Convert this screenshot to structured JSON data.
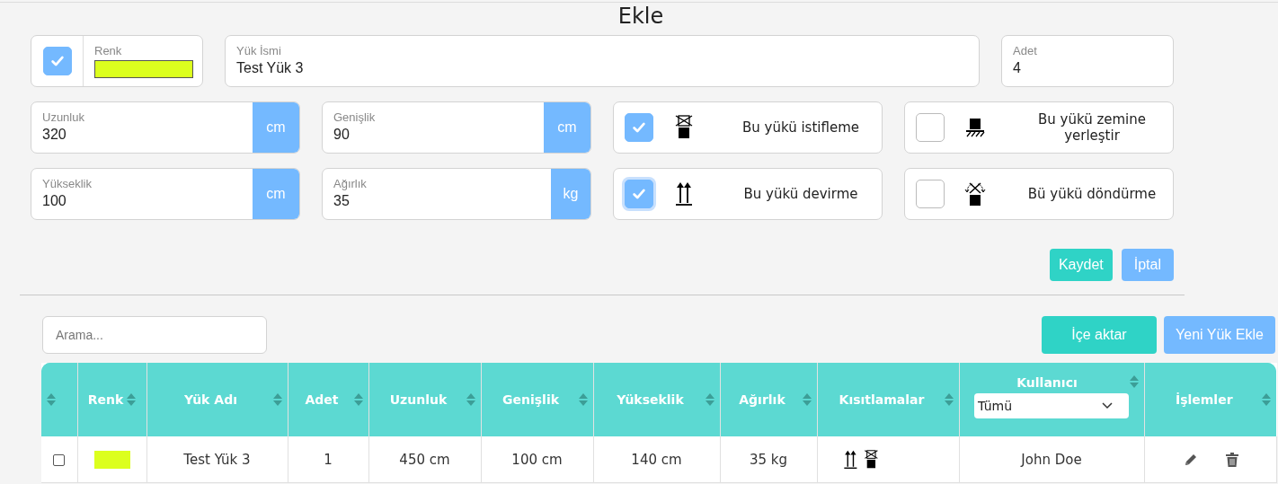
{
  "title": "Ekle",
  "form": {
    "color_field": {
      "label": "Renk",
      "checked": true,
      "color": "#dcff1e"
    },
    "name_field": {
      "label": "Yük İsmi",
      "value": "Test Yük 3"
    },
    "quantity_field": {
      "label": "Adet",
      "value": "4"
    },
    "dimension_fields": [
      {
        "label": "Uzunluk",
        "value": "320",
        "unit": "cm"
      },
      {
        "label": "Genişlik",
        "value": "90",
        "unit": "cm"
      },
      {
        "label": "Yükseklik",
        "value": "100",
        "unit": "cm"
      },
      {
        "label": "Ağırlık",
        "value": "35",
        "unit": "kg"
      }
    ],
    "options": [
      {
        "kind": "no-stack",
        "label": "Bu yükü istifleme",
        "checked": true,
        "focused": false
      },
      {
        "kind": "floor",
        "label": "Bu yükü zemine yerleştir",
        "checked": false,
        "focused": false
      },
      {
        "kind": "this-way-up",
        "label": "Bu yükü devirme",
        "checked": true,
        "focused": true
      },
      {
        "kind": "no-rotate",
        "label": "Bü yükü döndürme",
        "checked": false,
        "focused": false
      }
    ],
    "buttons": [
      {
        "kind": "save",
        "label": "Kaydet"
      },
      {
        "kind": "cancel",
        "label": "İptal"
      }
    ]
  },
  "toolbar": {
    "search": {
      "placeholder": "Arama..."
    },
    "buttons": [
      {
        "kind": "import",
        "label": "İçe aktar"
      },
      {
        "kind": "add",
        "label": "Yeni Yük Ekle"
      }
    ]
  },
  "table": {
    "columns": [
      {
        "sortable": true
      },
      {
        "label": "Renk",
        "sortable": true
      },
      {
        "label": "Yük Adı",
        "sortable": true
      },
      {
        "label": "Adet",
        "sortable": true
      },
      {
        "label": "Uzunluk",
        "sortable": true
      },
      {
        "label": "Genişlik",
        "sortable": true
      },
      {
        "label": "Yükseklik",
        "sortable": true
      },
      {
        "label": "Ağırlık",
        "sortable": true
      },
      {
        "label": "Kısıtlamalar",
        "sortable": true
      },
      {
        "label": "Kullanıcı",
        "sortable": true,
        "filter": "Tümü"
      },
      {
        "label": "İşlemler",
        "sortable": true
      }
    ],
    "rows": [
      {
        "selected": false,
        "color": "#dcff1e",
        "name": "Test Yük 3",
        "quantity": "1",
        "length": "450 cm",
        "width": "100 cm",
        "height": "140 cm",
        "weight": "35 kg",
        "constraints": [
          {
            "kind": "this-way-up"
          },
          {
            "kind": "no-stack"
          }
        ],
        "user": "John Doe",
        "actions": [
          {
            "kind": "edit"
          },
          {
            "kind": "delete"
          }
        ]
      }
    ]
  }
}
